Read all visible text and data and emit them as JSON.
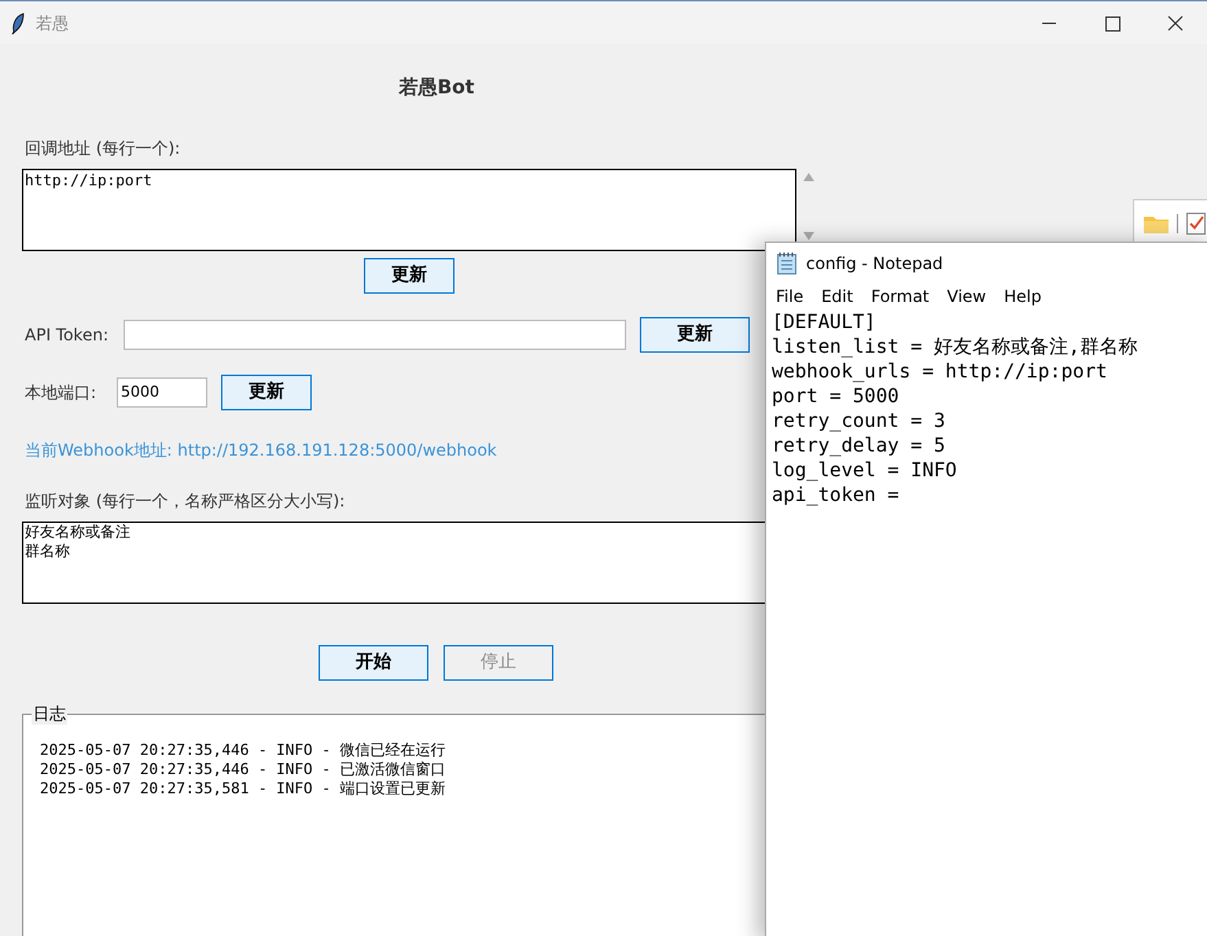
{
  "window": {
    "title": "若愚"
  },
  "app": {
    "heading": "若愚Bot",
    "callback": {
      "label": "回调地址 (每行一个):",
      "value": "http://ip:port",
      "button": "更新"
    },
    "token": {
      "label": "API Token:",
      "button": "更新"
    },
    "port": {
      "label": "本地端口:",
      "value": "5000",
      "button": "更新"
    },
    "webhook_link": "当前Webhook地址: http://192.168.191.128:5000/webhook",
    "listen": {
      "label": "监听对象 (每行一个，名称严格区分大小写):",
      "lines": [
        "好友名称或备注",
        "群名称"
      ]
    },
    "actions": [
      {
        "label": "开始",
        "disabled": false
      },
      {
        "label": "停止",
        "disabled": true
      }
    ],
    "log": {
      "title": "日志",
      "lines": [
        "2025-05-07 20:27:35,446 - INFO - 微信已经在运行",
        "2025-05-07 20:27:35,446 - INFO - 已激活微信窗口",
        "2025-05-07 20:27:35,581 - INFO - 端口设置已更新"
      ]
    }
  },
  "notepad": {
    "title": "config - Notepad",
    "menu": [
      "File",
      "Edit",
      "Format",
      "View",
      "Help"
    ],
    "lines": [
      "[DEFAULT]",
      "listen_list = 好友名称或备注,群名称",
      "webhook_urls = http://ip:port",
      "port = 5000",
      "retry_count = 3",
      "retry_delay = 5",
      "log_level = INFO",
      "api_token ="
    ]
  }
}
